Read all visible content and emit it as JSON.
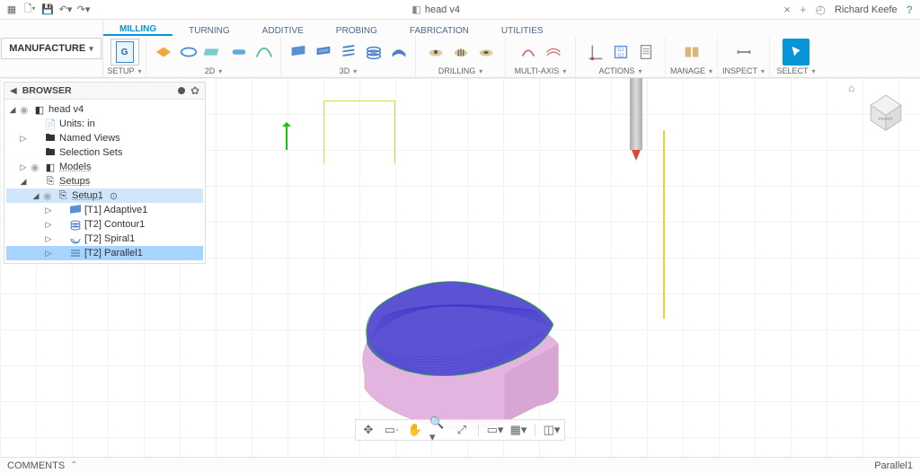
{
  "title": {
    "filename": "head v4",
    "close": "×",
    "plus": "+"
  },
  "user": {
    "name": "Richard Keefe"
  },
  "workspace": {
    "label": "MANUFACTURE"
  },
  "tabs": {
    "milling": "MILLING",
    "turning": "TURNING",
    "additive": "ADDITIVE",
    "probing": "PROBING",
    "fabrication": "FABRICATION",
    "utilities": "UTILITIES"
  },
  "groups": {
    "setup": "SETUP",
    "twod": "2D",
    "threed": "3D",
    "drilling": "DRILLING",
    "multiaxis": "MULTI-AXIS",
    "actions": "ACTIONS",
    "manage": "MANAGE",
    "inspect": "INSPECT",
    "select": "SELECT"
  },
  "setup_badge": "G",
  "browser": {
    "title": "BROWSER",
    "root": "head v4",
    "units": "Units: in",
    "named_views": "Named Views",
    "selection_sets": "Selection Sets",
    "models": "Models",
    "setups": "Setups",
    "setup1": "Setup1",
    "adaptive": "[T1] Adaptive1",
    "contour": "[T2] Contour1",
    "spiral": "[T2] Spiral1",
    "parallel": "[T2] Parallel1"
  },
  "status": {
    "comments": "COMMENTS",
    "right": "Parallel1"
  }
}
